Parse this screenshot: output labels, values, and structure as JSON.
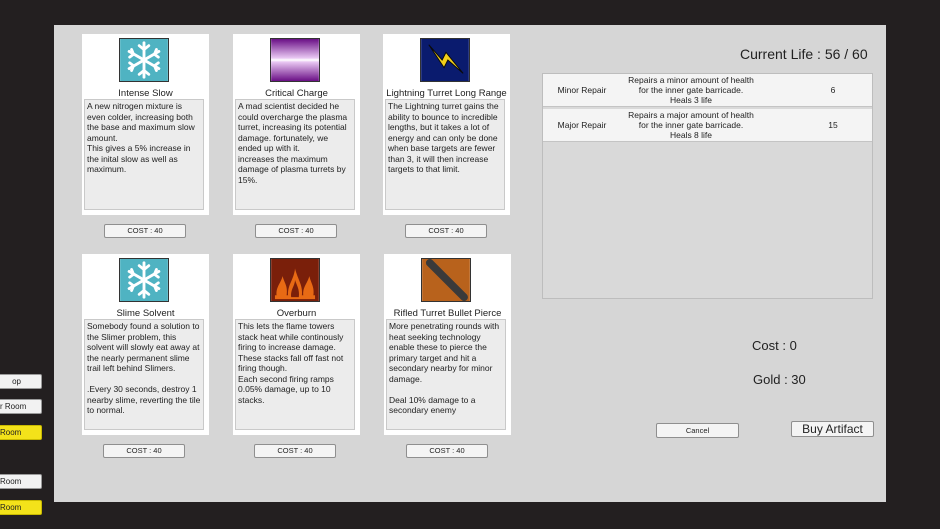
{
  "side_menu": [
    {
      "label": "op",
      "style": "white"
    },
    {
      "label": "r Room",
      "style": "white"
    },
    {
      "label": "Room",
      "style": "yellow"
    },
    {
      "label": "Room",
      "style": "white"
    },
    {
      "label": "Room",
      "style": "yellow"
    }
  ],
  "cards": [
    {
      "title": "Intense Slow",
      "icon": "snowflake-icon",
      "description": "A new nitrogen mixture is even colder, increasing both the base and maximum slow amount.\nThis gives a 5% increase in the inital slow as well as maximum.",
      "cost": "COST : 40"
    },
    {
      "title": "Critical Charge",
      "icon": "plasma-icon",
      "description": "A mad scientist decided he could overcharge the plasma turret, increasing its potential damage.  fortunately, we ended up with it.\nincreases the maximum damage of plasma turrets by 15%.",
      "cost": "COST : 40"
    },
    {
      "title": "Lightning Turret Long Range",
      "icon": "lightning-icon",
      "description": "The Lightning turret gains the ability to bounce to incredible lengths, but it takes a lot of energy and can only be done when base targets are fewer than 3, it will then increase targets to that limit.",
      "cost": "COST : 40"
    },
    {
      "title": "Slime Solvent",
      "icon": "snowflake-icon",
      "description": "Somebody found a solution to the Slimer problem, this solvent will slowly eat away at the nearly permanent slime trail left behind Slimers.\n\n.Every 30 seconds, destroy 1 nearby slime, reverting the tile to normal.",
      "cost": "COST : 40"
    },
    {
      "title": "Overburn",
      "icon": "flame-icon",
      "description": "This lets the flame towers stack heat while continously firing to increase damage. These stacks fall off fast not firing though.\nEach second firing ramps 0.05% damage, up to 10 stacks.",
      "cost": "COST : 40"
    },
    {
      "title": "Rifled Turret Bullet Pierce",
      "icon": "bullet-icon",
      "description": "More penetrating rounds with heat seeking technology enable these to pierce the primary target and hit a secondary nearby for minor damage.\n\nDeal 10% damage to a secondary enemy",
      "cost": "COST : 40"
    }
  ],
  "current_life": "Current Life : 56 / 60",
  "repairs": [
    {
      "name": "Minor Repair",
      "description": "Repairs a minor amount of health\nfor the inner gate barricade.\nHeals 3 life",
      "cost": "6"
    },
    {
      "name": "Major Repair",
      "description": "Repairs a major amount of health\nfor the inner gate barricade.\nHeals 8 life",
      "cost": "15"
    }
  ],
  "cost_total": "Cost : 0",
  "gold": "Gold :  30",
  "cancel_label": "Cancel",
  "buy_label": "Buy Artifact",
  "colors": {
    "snowflake_bg": "#4fb3c2",
    "plasma_bg": "#8a1fa8",
    "lightning_bg": "#0a1b6e",
    "lightning_bolt": "#f2cf1a",
    "flame_bg": "#7a1f0a",
    "flame_fg": "#e86a14",
    "bullet_bg": "#b8621c",
    "side_button_yellow": "#f3e21a"
  }
}
